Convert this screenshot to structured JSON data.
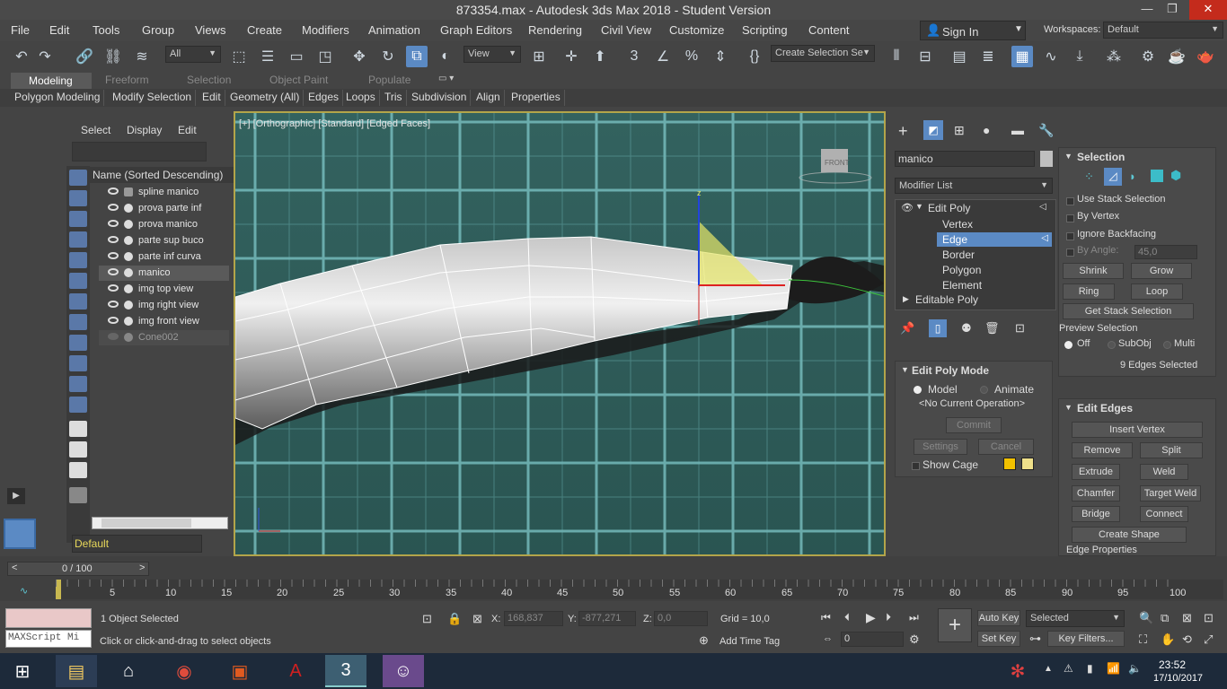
{
  "window": {
    "title": "873354.max - Autodesk 3ds Max 2018 - Student Version",
    "minimize": "—",
    "restore": "❐",
    "close": "✕"
  },
  "menus": [
    "File",
    "Edit",
    "Tools",
    "Group",
    "Views",
    "Create",
    "Modifiers",
    "Animation",
    "Graph Editors",
    "Rendering",
    "Civil View",
    "Customize",
    "Scripting",
    "Content"
  ],
  "account": {
    "sign_in": "Sign In",
    "workspaces_label": "Workspaces:",
    "workspace": "Default"
  },
  "toolbar": {
    "filter": "All",
    "ref_coord": "View",
    "selection_set": "Create Selection Se"
  },
  "ribbon": {
    "tabs": [
      "Modeling",
      "Freeform",
      "Selection",
      "Object Paint",
      "Populate"
    ],
    "sub": [
      "Polygon Modeling",
      "Modify Selection",
      "Edit",
      "Geometry (All)",
      "Edges",
      "Loops",
      "Tris",
      "Subdivision",
      "Align",
      "Properties"
    ]
  },
  "scene_explorer": {
    "tabs": [
      "Select",
      "Display",
      "Edit"
    ],
    "column": "Name (Sorted Descending)",
    "items": [
      "spline manico",
      "prova parte inf",
      "prova manico",
      "parte sup buco",
      "parte inf curva",
      "manico",
      "img top view",
      "img right view",
      "img front view",
      "Cone002"
    ],
    "layer": "Default"
  },
  "viewport": {
    "label": "[+] [Orthographic] [Standard] [Edged Faces]",
    "viewcube": "FRONT",
    "gizmo_z": "z"
  },
  "command_panel": {
    "object_name": "manico",
    "modifier_list": "Modifier List",
    "stack": [
      "Edit Poly",
      "Vertex",
      "Edge",
      "Border",
      "Polygon",
      "Element",
      "Editable Poly"
    ],
    "edit_poly_mode": {
      "title": "Edit Poly Mode",
      "model": "Model",
      "animate": "Animate",
      "op": "<No Current Operation>",
      "commit": "Commit",
      "settings": "Settings",
      "cancel": "Cancel",
      "show_cage": "Show Cage"
    },
    "selection": {
      "title": "Selection",
      "use_stack": "Use Stack Selection",
      "by_vertex": "By Vertex",
      "ignore_backfacing": "Ignore Backfacing",
      "by_angle": "By Angle:",
      "angle": "45,0",
      "shrink": "Shrink",
      "grow": "Grow",
      "ring": "Ring",
      "loop": "Loop",
      "get_stack": "Get Stack Selection",
      "preview": "Preview Selection",
      "off": "Off",
      "subobj": "SubObj",
      "multi": "Multi",
      "count": "9 Edges Selected"
    },
    "edit_edges": {
      "title": "Edit Edges",
      "insert_vertex": "Insert Vertex",
      "remove": "Remove",
      "split": "Split",
      "extrude": "Extrude",
      "weld": "Weld",
      "chamfer": "Chamfer",
      "target_weld": "Target Weld",
      "bridge": "Bridge",
      "connect": "Connect",
      "create_shape": "Create Shape",
      "edge_props": "Edge Properties"
    }
  },
  "timeline": {
    "frame": "0 / 100",
    "ticks": [
      "5",
      "10",
      "15",
      "20",
      "25",
      "30",
      "35",
      "40",
      "45",
      "50",
      "55",
      "60",
      "65",
      "70",
      "75",
      "80",
      "85",
      "90",
      "95",
      "100"
    ]
  },
  "status": {
    "selected": "1 Object Selected",
    "prompt": "Click or click-and-drag to select objects",
    "x_label": "X:",
    "x": "168,837",
    "y_label": "Y:",
    "y": "-877,271",
    "z_label": "Z:",
    "z": "0,0",
    "grid": "Grid = 10,0",
    "add_time_tag": "Add Time Tag",
    "auto_key": "Auto Key",
    "set_key": "Set Key",
    "key_mode": "Selected",
    "key_filters": "Key Filters...",
    "frame": "0",
    "maxscript": "MAXScript Mi"
  },
  "taskbar": {
    "time": "23:52",
    "date": "17/10/2017"
  }
}
